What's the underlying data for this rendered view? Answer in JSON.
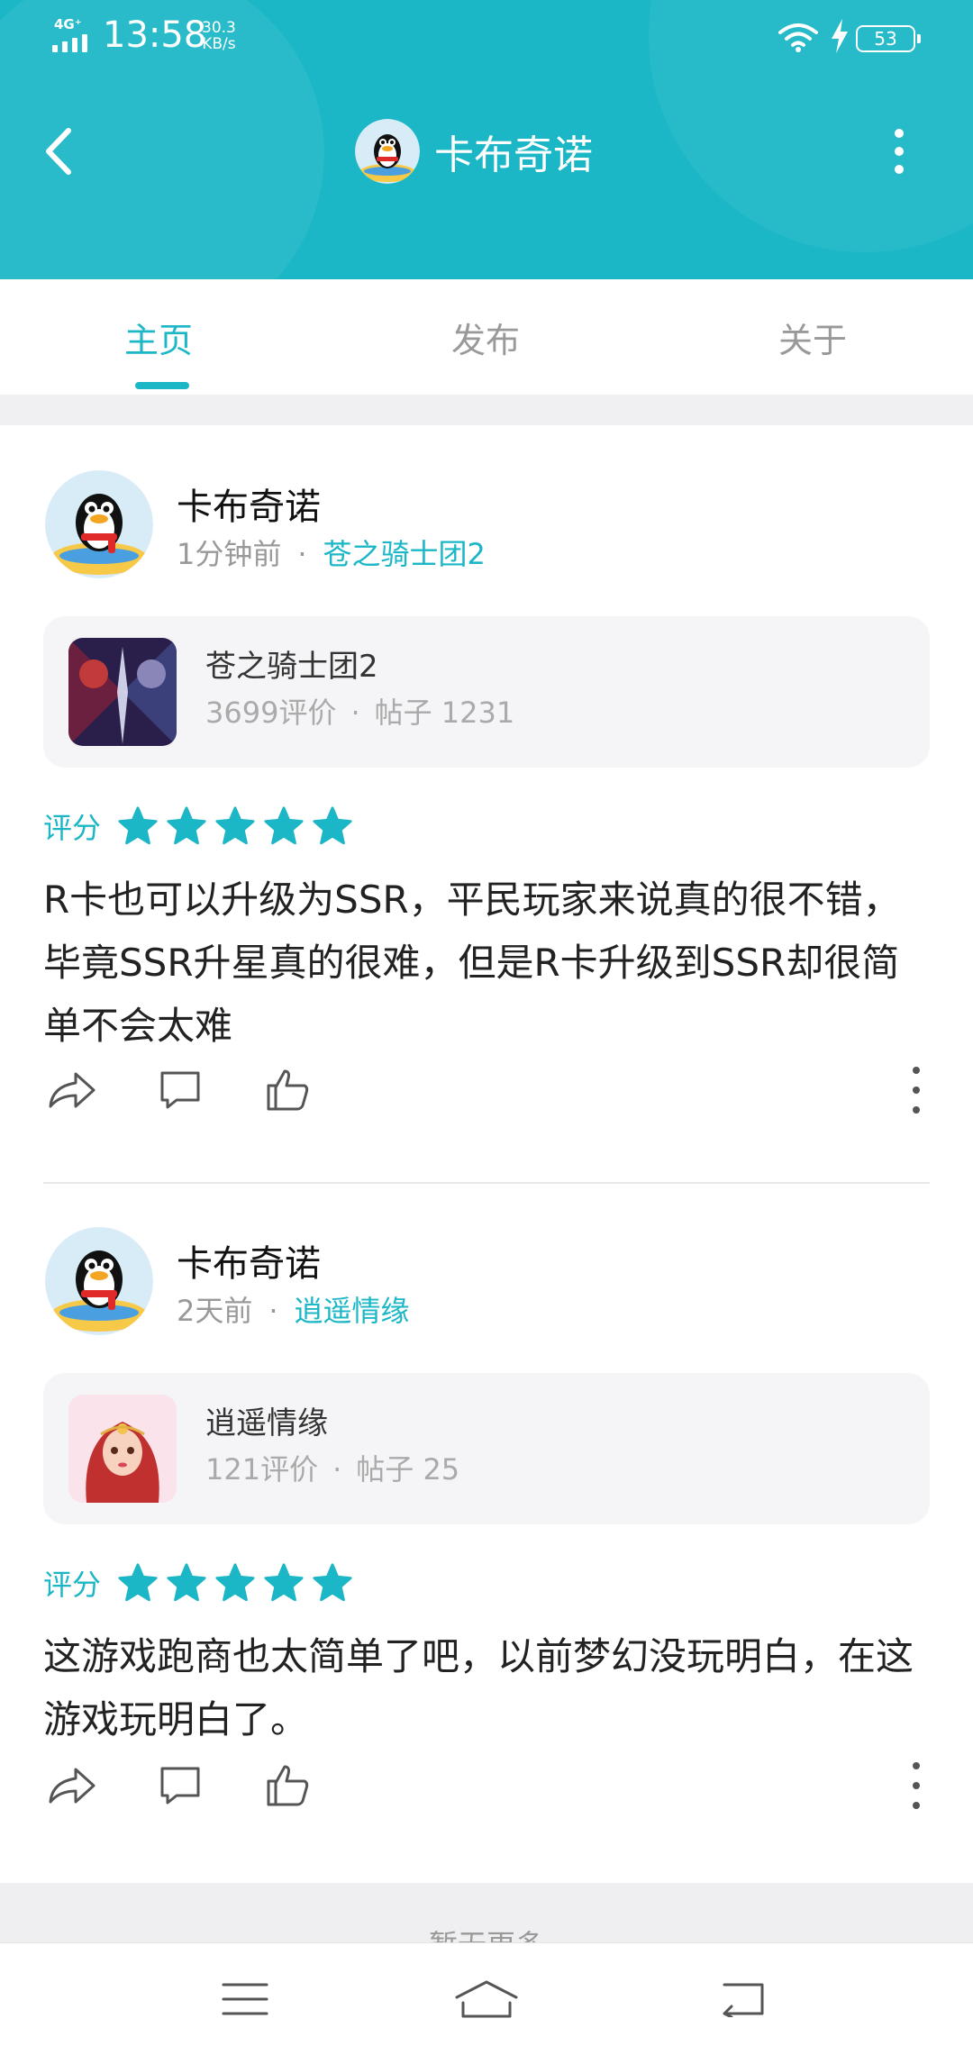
{
  "status_bar": {
    "network": "4G⁺",
    "time": "13:58",
    "speed_value": "30.3",
    "speed_unit": "KB/s",
    "battery": "53",
    "icons": [
      "signal-icon",
      "wifi-icon",
      "charging-icon",
      "battery-icon"
    ]
  },
  "header": {
    "title": "卡布奇诺",
    "background_color": "#1cb7c6",
    "icons": [
      "back-icon",
      "avatar",
      "more-vertical-icon"
    ]
  },
  "tabs": [
    {
      "label": "主页",
      "active": true
    },
    {
      "label": "发布",
      "active": false
    },
    {
      "label": "关于",
      "active": false
    }
  ],
  "posts": [
    {
      "author": "卡布奇诺",
      "time": "1分钟前",
      "separator": "·",
      "game_link": "苍之骑士团2",
      "game": {
        "name": "苍之骑士团2",
        "reviews": "3699评价",
        "separator": "·",
        "posts": "帖子 1231"
      },
      "rating_label": "评分",
      "rating": 5,
      "body": "R卡也可以升级为SSR，平民玩家来说真的很不错，毕竟SSR升星真的很难，但是R卡升级到SSR却很简单不会太难"
    },
    {
      "author": "卡布奇诺",
      "time": "2天前",
      "separator": "·",
      "game_link": "逍遥情缘",
      "game": {
        "name": "逍遥情缘",
        "reviews": "121评价",
        "separator": "·",
        "posts": "帖子 25"
      },
      "rating_label": "评分",
      "rating": 5,
      "body": "这游戏跑商也太简单了吧，以前梦幻没玩明白，在这游戏玩明白了。"
    }
  ],
  "post_action_icons": [
    "share-icon",
    "comment-icon",
    "like-icon",
    "more-vertical-icon"
  ],
  "load_more": "暂无更多",
  "nav_bar": {
    "icons": [
      "menu-icon",
      "home-icon",
      "back-icon"
    ]
  },
  "colors": {
    "accent": "#1cb7c6",
    "star": "#1cb7c6"
  }
}
